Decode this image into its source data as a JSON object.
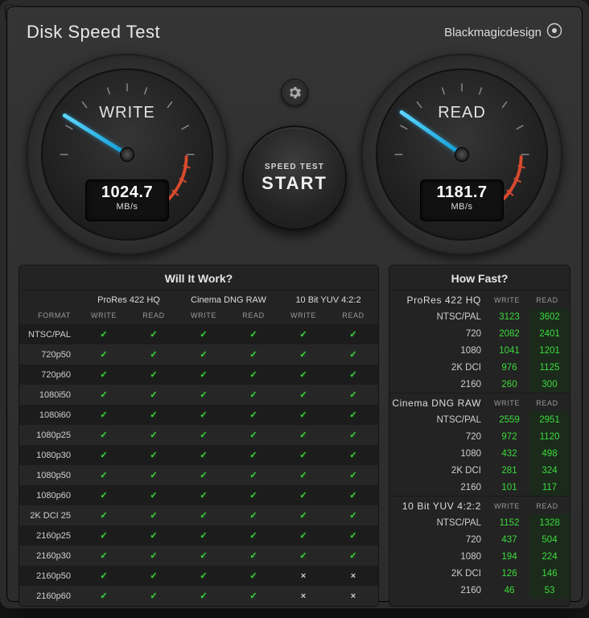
{
  "window": {
    "title": "Disk Speed Test",
    "brand": "Blackmagicdesign"
  },
  "start": {
    "line1": "SPEED TEST",
    "line2": "START"
  },
  "gauges": {
    "write": {
      "label": "WRITE",
      "value": "1024.7",
      "unit": "MB/s",
      "angle": 212
    },
    "read": {
      "label": "READ",
      "value": "1181.7",
      "unit": "MB/s",
      "angle": 215
    }
  },
  "wiw": {
    "title": "Will It Work?",
    "format_header": "FORMAT",
    "codecs": [
      "ProRes 422 HQ",
      "Cinema DNG RAW",
      "10 Bit YUV 4:2:2"
    ],
    "sub": [
      "WRITE",
      "READ"
    ],
    "rows": [
      {
        "fmt": "NTSC/PAL",
        "cells": [
          true,
          true,
          true,
          true,
          true,
          true
        ]
      },
      {
        "fmt": "720p50",
        "cells": [
          true,
          true,
          true,
          true,
          true,
          true
        ]
      },
      {
        "fmt": "720p60",
        "cells": [
          true,
          true,
          true,
          true,
          true,
          true
        ]
      },
      {
        "fmt": "1080i50",
        "cells": [
          true,
          true,
          true,
          true,
          true,
          true
        ]
      },
      {
        "fmt": "1080i60",
        "cells": [
          true,
          true,
          true,
          true,
          true,
          true
        ]
      },
      {
        "fmt": "1080p25",
        "cells": [
          true,
          true,
          true,
          true,
          true,
          true
        ]
      },
      {
        "fmt": "1080p30",
        "cells": [
          true,
          true,
          true,
          true,
          true,
          true
        ]
      },
      {
        "fmt": "1080p50",
        "cells": [
          true,
          true,
          true,
          true,
          true,
          true
        ]
      },
      {
        "fmt": "1080p60",
        "cells": [
          true,
          true,
          true,
          true,
          true,
          true
        ]
      },
      {
        "fmt": "2K DCI 25",
        "cells": [
          true,
          true,
          true,
          true,
          true,
          true
        ]
      },
      {
        "fmt": "2160p25",
        "cells": [
          true,
          true,
          true,
          true,
          true,
          true
        ]
      },
      {
        "fmt": "2160p30",
        "cells": [
          true,
          true,
          true,
          true,
          true,
          true
        ]
      },
      {
        "fmt": "2160p50",
        "cells": [
          true,
          true,
          true,
          true,
          false,
          false
        ]
      },
      {
        "fmt": "2160p60",
        "cells": [
          true,
          true,
          true,
          true,
          false,
          false
        ]
      }
    ]
  },
  "hf": {
    "title": "How Fast?",
    "sub": [
      "WRITE",
      "READ"
    ],
    "blocks": [
      {
        "codec": "ProRes 422 HQ",
        "rows": [
          {
            "lbl": "NTSC/PAL",
            "w": "3123",
            "r": "3602"
          },
          {
            "lbl": "720",
            "w": "2082",
            "r": "2401"
          },
          {
            "lbl": "1080",
            "w": "1041",
            "r": "1201"
          },
          {
            "lbl": "2K DCI",
            "w": "976",
            "r": "1125"
          },
          {
            "lbl": "2160",
            "w": "260",
            "r": "300"
          }
        ]
      },
      {
        "codec": "Cinema DNG RAW",
        "rows": [
          {
            "lbl": "NTSC/PAL",
            "w": "2559",
            "r": "2951"
          },
          {
            "lbl": "720",
            "w": "972",
            "r": "1120"
          },
          {
            "lbl": "1080",
            "w": "432",
            "r": "498"
          },
          {
            "lbl": "2K DCI",
            "w": "281",
            "r": "324"
          },
          {
            "lbl": "2160",
            "w": "101",
            "r": "117"
          }
        ]
      },
      {
        "codec": "10 Bit YUV 4:2:2",
        "rows": [
          {
            "lbl": "NTSC/PAL",
            "w": "1152",
            "r": "1328"
          },
          {
            "lbl": "720",
            "w": "437",
            "r": "504"
          },
          {
            "lbl": "1080",
            "w": "194",
            "r": "224"
          },
          {
            "lbl": "2K DCI",
            "w": "126",
            "r": "146"
          },
          {
            "lbl": "2160",
            "w": "46",
            "r": "53"
          }
        ]
      }
    ]
  }
}
